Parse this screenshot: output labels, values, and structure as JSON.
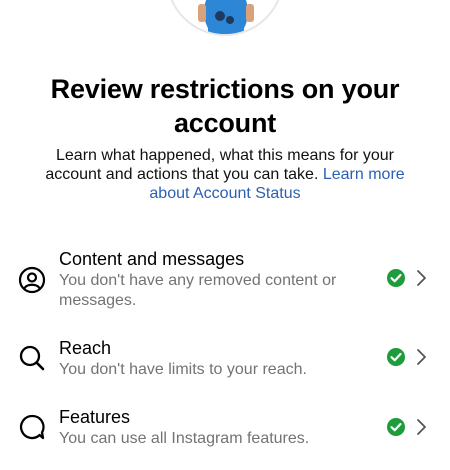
{
  "header": {
    "title": "Review restrictions on your account",
    "subtitle": "Learn what happened, what this means for your account and actions that you can take.",
    "learn_more_link": "Learn more about Account Status"
  },
  "colors": {
    "link": "#2b5fb4",
    "status_ok": "#1e9c3c",
    "secondary_text": "#737373"
  },
  "restrictions": [
    {
      "icon": "person-circle-icon",
      "title": "Content and messages",
      "description": "You don't have any removed content or messages.",
      "status": "ok"
    },
    {
      "icon": "search-icon",
      "title": "Reach",
      "description": "You don't have limits to your reach.",
      "status": "ok"
    },
    {
      "icon": "speech-bubble-icon",
      "title": "Features",
      "description": "You can use all Instagram features.",
      "status": "ok"
    }
  ]
}
